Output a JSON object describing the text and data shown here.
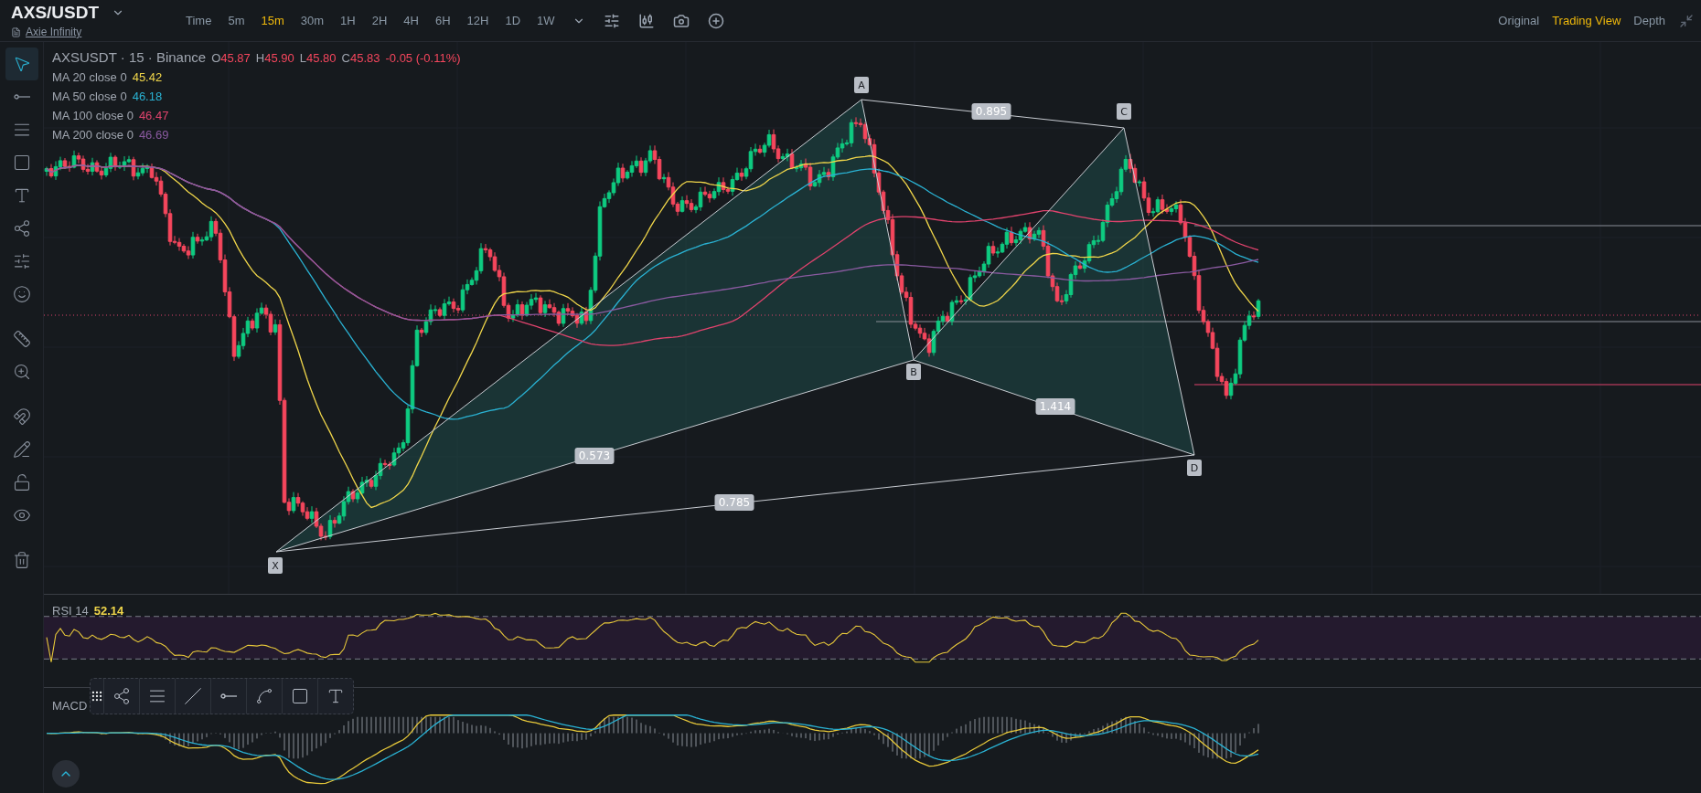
{
  "header": {
    "symbol": "AXS/USDT",
    "name": "Axie Infinity",
    "intervals": [
      {
        "label": "Time",
        "selected": false
      },
      {
        "label": "5m",
        "selected": false
      },
      {
        "label": "15m",
        "selected": true
      },
      {
        "label": "30m",
        "selected": false
      },
      {
        "label": "1H",
        "selected": false
      },
      {
        "label": "2H",
        "selected": false
      },
      {
        "label": "4H",
        "selected": false
      },
      {
        "label": "6H",
        "selected": false
      },
      {
        "label": "12H",
        "selected": false
      },
      {
        "label": "1D",
        "selected": false
      },
      {
        "label": "1W",
        "selected": false
      }
    ],
    "views": [
      {
        "label": "Original",
        "selected": false
      },
      {
        "label": "Trading View",
        "selected": true
      },
      {
        "label": "Depth",
        "selected": false
      }
    ]
  },
  "tools": [
    {
      "kind": "cursor",
      "selected": true
    },
    {
      "kind": "line",
      "selected": false
    },
    {
      "kind": "lines",
      "selected": false
    },
    {
      "kind": "rectangle",
      "selected": false
    },
    {
      "kind": "text",
      "selected": false
    },
    {
      "kind": "pattern",
      "selected": false
    },
    {
      "kind": "measure",
      "selected": false
    },
    {
      "kind": "emoji",
      "selected": false
    },
    {
      "kind": "ruler",
      "selected": false
    },
    {
      "kind": "zoom",
      "selected": false
    },
    {
      "kind": "magnet",
      "selected": false
    },
    {
      "kind": "lock-drawing",
      "selected": false
    },
    {
      "kind": "lock",
      "selected": false
    },
    {
      "kind": "eye",
      "selected": false
    },
    {
      "kind": "trash",
      "selected": false
    }
  ],
  "legend": {
    "title": "AXSUSDT · 15 · Binance",
    "ohlc": [
      {
        "label": "O",
        "value": "45.87"
      },
      {
        "label": "H",
        "value": "45.90"
      },
      {
        "label": "L",
        "value": "45.80"
      },
      {
        "label": "C",
        "value": "45.83"
      }
    ],
    "change": "-0.05 (-0.11%)",
    "ma": [
      {
        "label": "MA 20 close 0",
        "value": "45.42",
        "color": "#f0d64a"
      },
      {
        "label": "MA 50 close 0",
        "value": "46.18",
        "color": "#2ab2d3"
      },
      {
        "label": "MA 100 close 0",
        "value": "46.47",
        "color": "#e0436d"
      },
      {
        "label": "MA 200 close 0",
        "value": "46.69",
        "color": "#8a5aa0"
      }
    ]
  },
  "pattern": {
    "points": [
      {
        "label": "X"
      },
      {
        "label": "A"
      },
      {
        "label": "B"
      },
      {
        "label": "C"
      },
      {
        "label": "D"
      }
    ],
    "ratios": [
      "0.895",
      "0.573",
      "1.414",
      "0.785"
    ]
  },
  "rsi": {
    "label": "RSI 14",
    "value": "52.14"
  },
  "macd": {
    "label": "MACD"
  }
}
